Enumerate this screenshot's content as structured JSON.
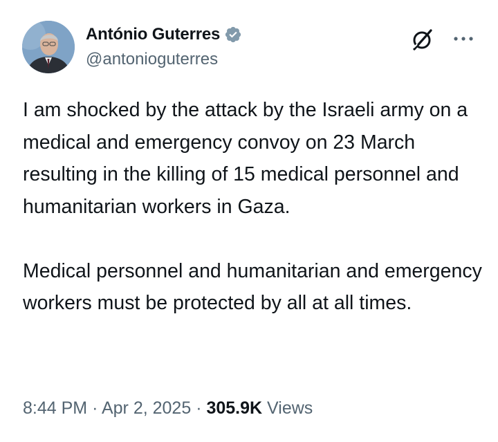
{
  "author": {
    "display_name": "António Guterres",
    "handle": "@antonioguterres",
    "verified": true,
    "verified_badge_color": "#829aab"
  },
  "post": {
    "text": "I am shocked by the attack by the Israeli army on a medical and emergency convoy on 23 March resulting in the killing of 15 medical personnel and humanitarian workers in Gaza.\n\nMedical personnel and humanitarian and emergency workers must be protected by all at all times.",
    "time": "8:44 PM",
    "separator": "·",
    "date": "Apr 2, 2025",
    "views_count": "305.9K",
    "views_label": "Views"
  },
  "icons": {
    "grok": "grok-icon",
    "more": "more-options-icon",
    "verified": "verified-badge-icon"
  },
  "colors": {
    "text": "#0f1419",
    "secondary_text": "#536471",
    "background": "#ffffff"
  }
}
